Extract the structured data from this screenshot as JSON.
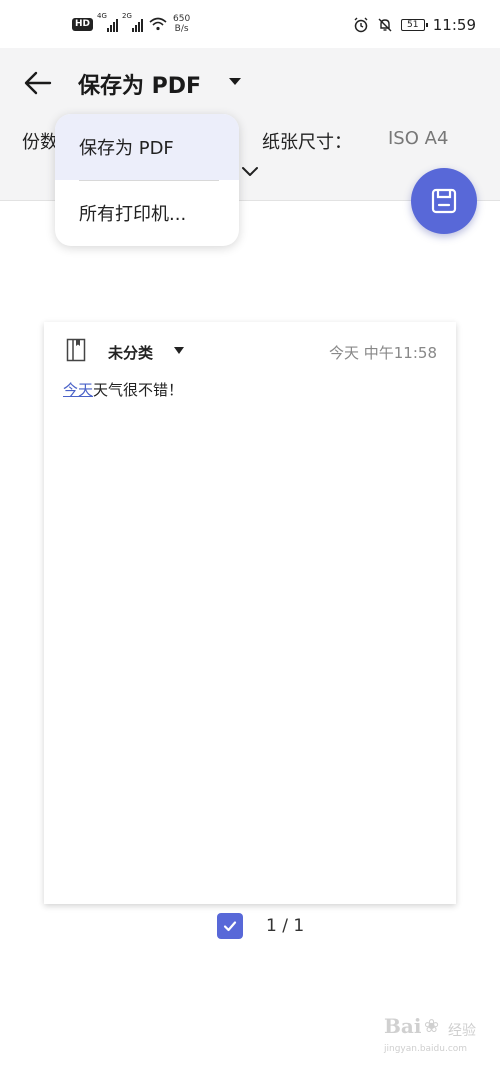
{
  "status_bar": {
    "hd_badge": "HD",
    "signal1_tag": "4G",
    "signal2_tag": "2G",
    "net_speed_value": "650",
    "net_speed_unit": "B/s",
    "battery": "51",
    "time": "11:59"
  },
  "header": {
    "title": "保存为 PDF",
    "copies_label": "份数",
    "paper_size_label": "纸张尺寸：",
    "paper_size_value": "ISO A4"
  },
  "dropdown": {
    "items": [
      {
        "label": "保存为 PDF",
        "selected": true
      },
      {
        "label": "所有打印机..."
      }
    ]
  },
  "preview": {
    "category": "未分类",
    "timestamp": "今天 中午11:58",
    "note_link_text": "今天",
    "note_text": "天气很不错！"
  },
  "page_indicator": {
    "checked": true,
    "counter": "1 / 1"
  },
  "watermark": {
    "brand": "Bai",
    "brand_cn": "经验",
    "url": "jingyan.baidu.com"
  },
  "colors": {
    "accent": "#5868d8",
    "link": "#4a62c8",
    "selected_bg": "#eceefa",
    "header_bg": "#f4f4f5"
  },
  "icons": [
    "back-arrow-icon",
    "dropdown-caret-icon",
    "chevron-down-icon",
    "save-icon",
    "notebook-icon",
    "checkbox-icon",
    "alarm-icon",
    "bell-off-icon",
    "wifi-icon",
    "battery-icon"
  ]
}
